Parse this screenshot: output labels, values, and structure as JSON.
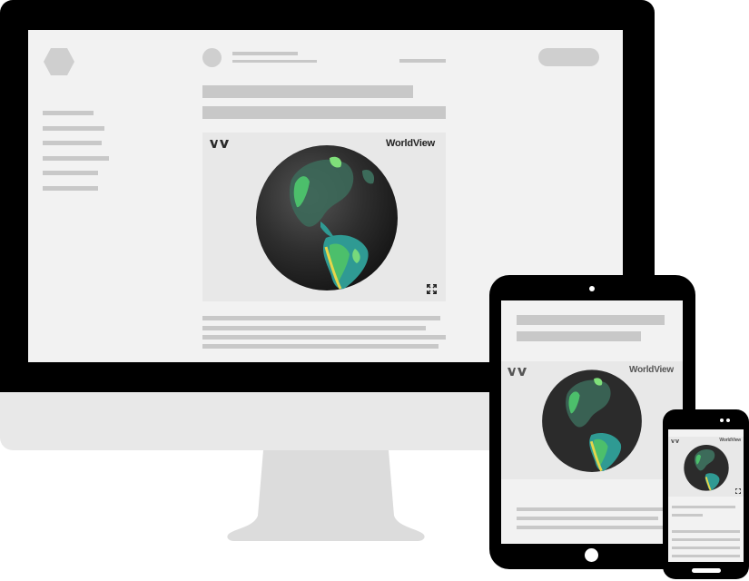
{
  "embed": {
    "brand_label": "WorldView",
    "logo_glyph": "WV",
    "expand_icon": "expand-icon"
  },
  "colors": {
    "device_frame": "#000000",
    "screen_bg": "#f2f2f2",
    "placeholder": "#c8c8c8",
    "embed_bg": "#e8e8e8",
    "stand": "#dcdcdc",
    "globe_dark": "#2b2b2b",
    "vegetation_green": "#4cbf6b",
    "vegetation_teal": "#2f9a93",
    "vegetation_yellow": "#e6d64a"
  }
}
